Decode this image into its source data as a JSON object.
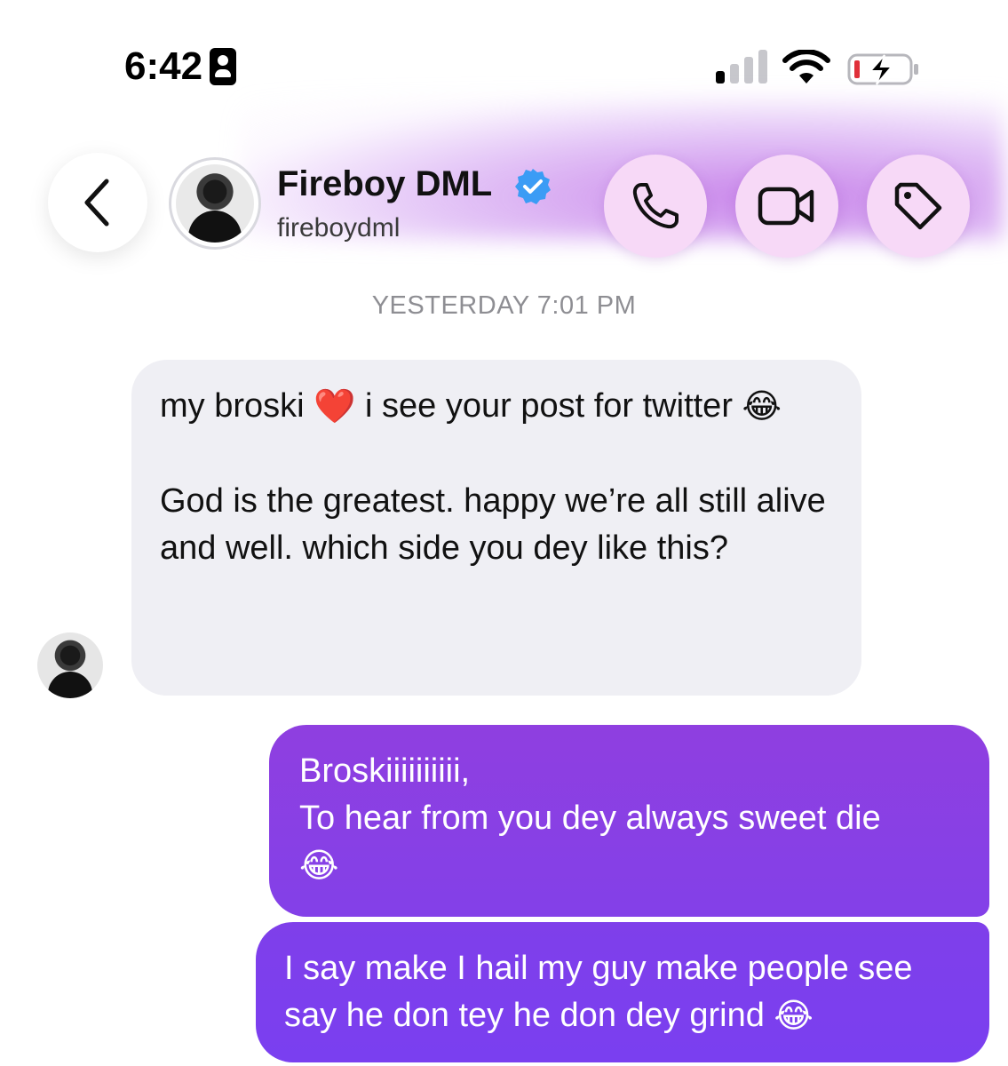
{
  "status_bar": {
    "time": "6:42",
    "icons": [
      "id-card-icon",
      "cellular-signal-icon",
      "wifi-icon",
      "battery-charging-icon"
    ]
  },
  "header": {
    "contact_name": "Fireboy DML",
    "contact_handle": "fireboydml",
    "verified": true,
    "accent_color": "#c07ae0",
    "buttons": [
      "back-chevron-icon",
      "phone-icon",
      "video-camera-icon",
      "tag-icon"
    ]
  },
  "conversation": {
    "timestamp": "YESTERDAY 7:01 PM",
    "incoming": {
      "line1": "my broski",
      "line1b": "i see your post for twitter",
      "emoji_heart": "❤️",
      "emoji_laugh": "😂",
      "para2": "God is the greatest. happy we’re all still alive and well. which side you dey like this?"
    },
    "outgoing": [
      {
        "line1": "Broskiiiiiiiiii,",
        "line2": "To hear from you dey always sweet die",
        "emoji": "😂"
      },
      {
        "text": "I say make I hail my guy make people see say he don tey he don dey grind",
        "emoji": "😂"
      }
    ],
    "colors": {
      "incoming_bubble": "#efeff4",
      "outgoing_bubble": "#8340e8"
    }
  }
}
